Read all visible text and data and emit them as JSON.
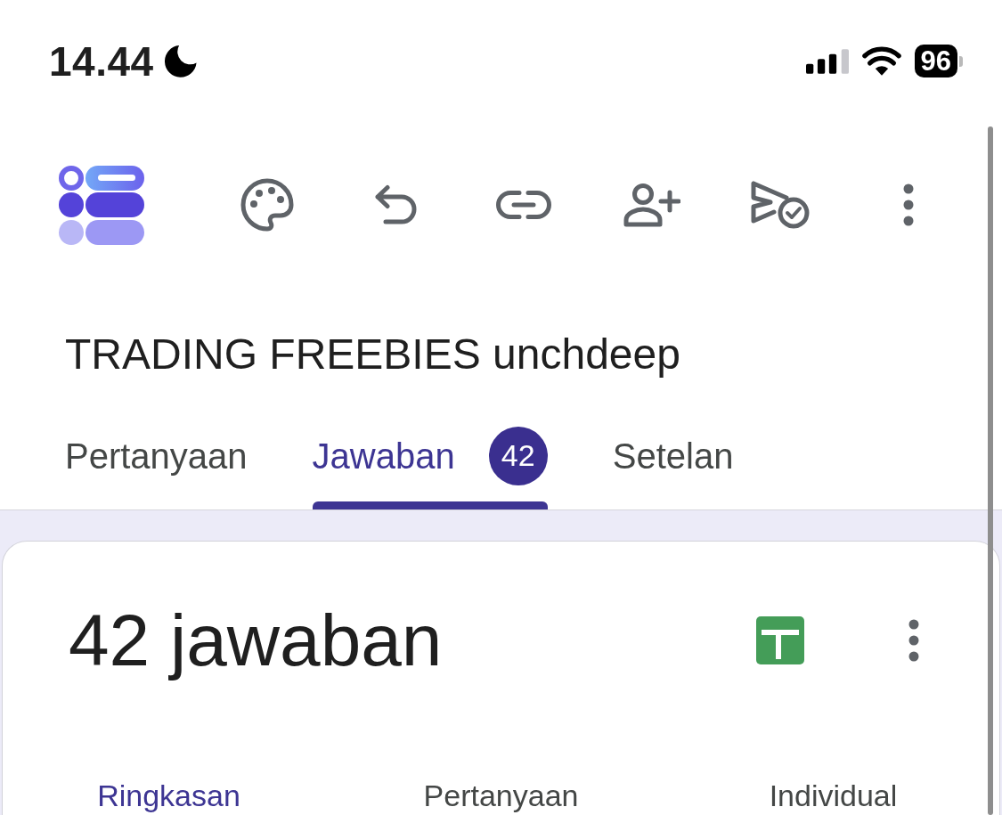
{
  "status_bar": {
    "time": "14.44",
    "battery": "96"
  },
  "form": {
    "title": "TRADING FREEBIES unchdeep"
  },
  "tabs": [
    {
      "label": "Pertanyaan",
      "selected": false
    },
    {
      "label": "Jawaban",
      "selected": true,
      "badge": "42"
    },
    {
      "label": "Setelan",
      "selected": false
    }
  ],
  "responses": {
    "heading": "42 jawaban",
    "tabs": [
      {
        "label": "Ringkasan",
        "selected": true
      },
      {
        "label": "Pertanyaan",
        "selected": false
      },
      {
        "label": "Individual",
        "selected": false
      }
    ]
  }
}
